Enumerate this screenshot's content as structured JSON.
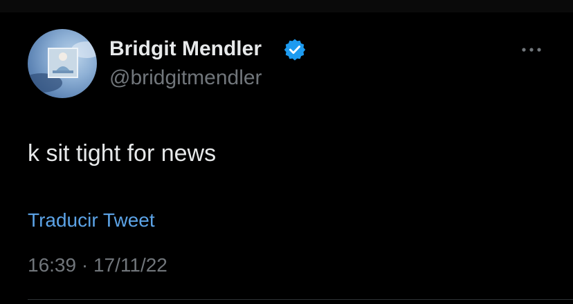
{
  "author": {
    "display_name": "Bridgit Mendler",
    "handle": "@bridgitmendler",
    "verified_icon": "verified-badge",
    "avatar_icon": "profile-photo"
  },
  "tweet": {
    "text": "k sit tight for news",
    "translate_label": "Traducir Tweet",
    "time": "16:39",
    "separator": "·",
    "date": "17/11/22",
    "more_icon": "more-options"
  },
  "colors": {
    "background": "#000000",
    "primary_text": "#e7e9ea",
    "secondary_text": "#71767b",
    "link": "#5ca3e6",
    "verified": "#1d9bf0"
  }
}
